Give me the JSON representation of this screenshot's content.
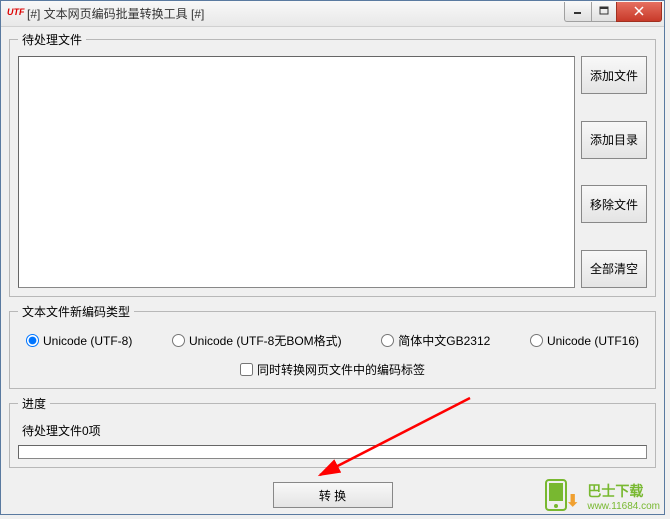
{
  "window": {
    "title": "[#] 文本网页编码批量转换工具 [#]"
  },
  "groups": {
    "files_label": "待处理文件",
    "encoding_label": "文本文件新编码类型",
    "progress_label": "进度"
  },
  "buttons": {
    "add_file": "添加文件",
    "add_dir": "添加目录",
    "remove_file": "移除文件",
    "clear_all": "全部清空",
    "convert": "转 换"
  },
  "encoding": {
    "options": [
      {
        "label": "Unicode (UTF-8)",
        "checked": true
      },
      {
        "label": "Unicode (UTF-8无BOM格式)",
        "checked": false
      },
      {
        "label": "简体中文GB2312",
        "checked": false
      },
      {
        "label": "Unicode (UTF16)",
        "checked": false
      }
    ],
    "checkbox_label": "同时转换网页文件中的编码标签"
  },
  "progress": {
    "text": "待处理文件0项"
  },
  "watermark": {
    "name": "巴士下载",
    "url": "www.11684.com"
  }
}
